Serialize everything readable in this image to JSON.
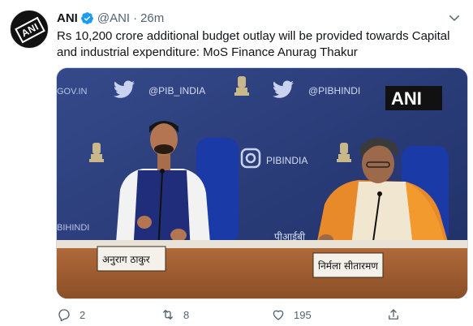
{
  "tweet": {
    "display_name": "ANI",
    "handle": "@ANI",
    "separator": "·",
    "time": "26m",
    "text": "Rs 10,200 crore additional budget outlay will be provided towards Capital and industrial expenditure: MoS Finance Anurag Thakur"
  },
  "avatar": {
    "logo_text": "ANI"
  },
  "media": {
    "watermark": "ANI",
    "backdrop": {
      "site_left": "GOV.IN",
      "handle_1": "@PIB_INDIA",
      "handle_2": "@PIBHINDI",
      "pib_label": "PIBINDIA",
      "bihindi": "BIHINDI",
      "pib_hindi": "पीआईबी"
    },
    "nameplate_left": "अनुराग ठाकुर",
    "nameplate_right": "निर्मला सीतारमण"
  },
  "actions": {
    "reply_count": "2",
    "retweet_count": "8",
    "like_count": "195"
  },
  "colors": {
    "accent": "#1d9bf0",
    "muted": "#536471",
    "backdrop_blue": "#2c3f7a"
  }
}
